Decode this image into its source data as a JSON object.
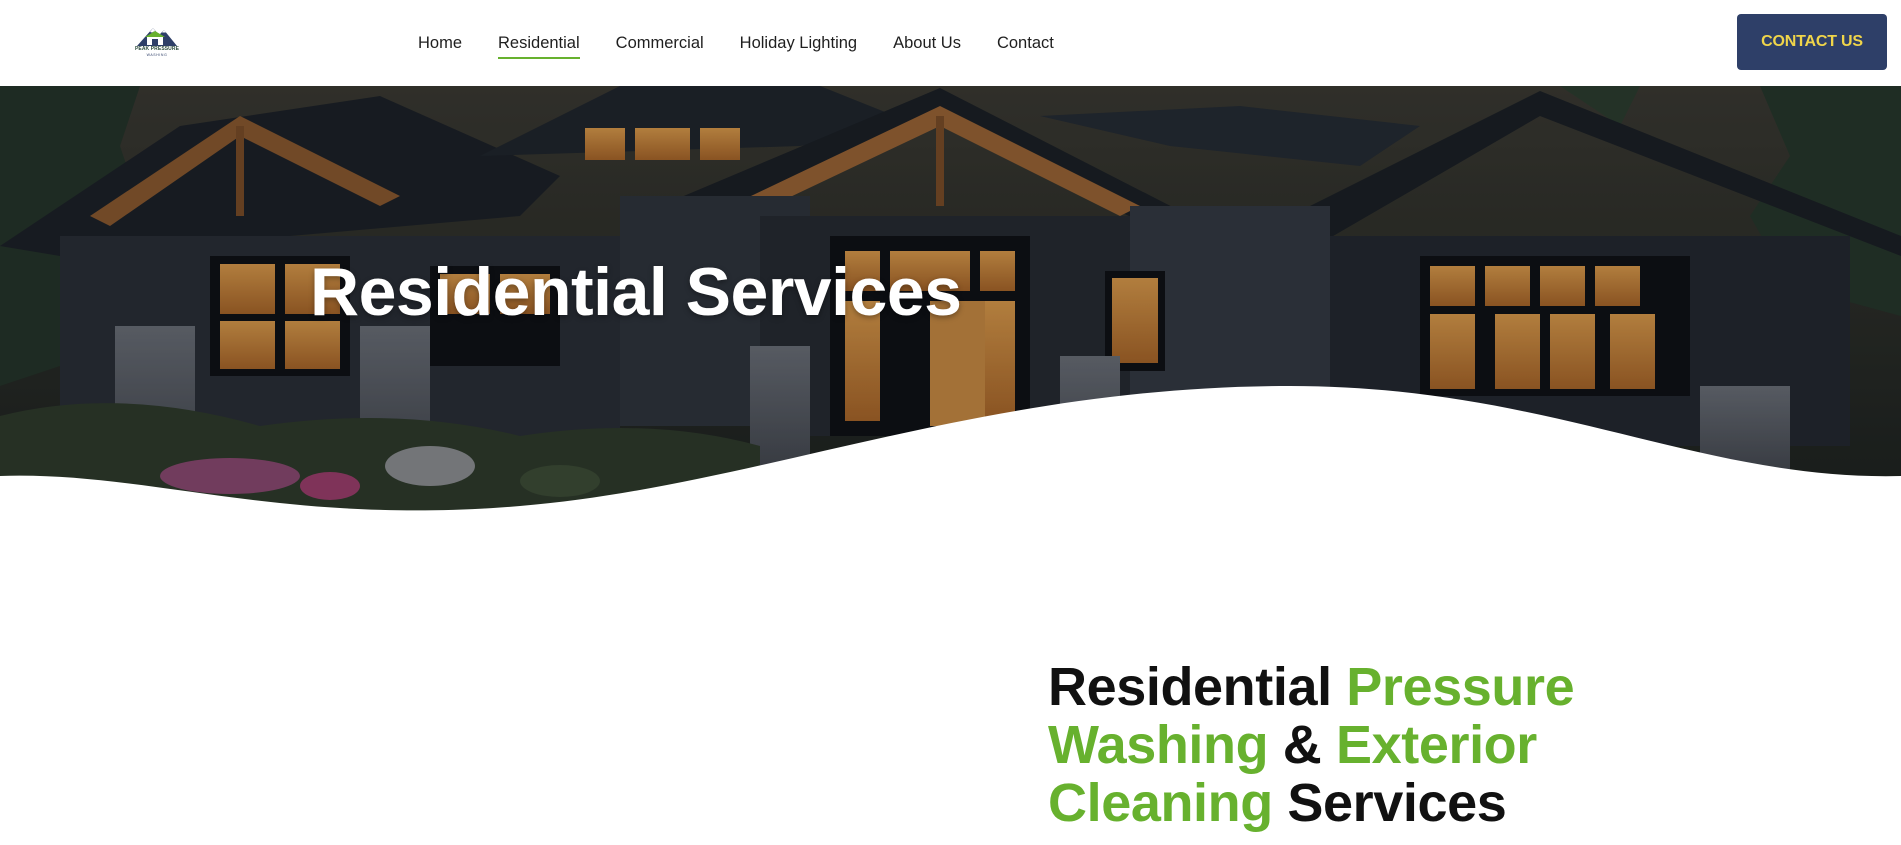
{
  "header": {
    "logo_text": "PEAK PRESSURE",
    "logo_sub": "WASHING",
    "nav": [
      {
        "label": "Home",
        "active": false
      },
      {
        "label": "Residential",
        "active": true
      },
      {
        "label": "Commercial",
        "active": false
      },
      {
        "label": "Holiday Lighting",
        "active": false
      },
      {
        "label": "About Us",
        "active": false
      },
      {
        "label": "Contact",
        "active": false
      }
    ],
    "cta_label": "CONTACT US"
  },
  "hero": {
    "title": "Residential Services"
  },
  "section": {
    "heading_parts": [
      {
        "text": "Residential ",
        "highlight": false
      },
      {
        "text": "Pressure Washing",
        "highlight": true
      },
      {
        "text": " & ",
        "highlight": false
      },
      {
        "text": "Exterior Cleaning",
        "highlight": true
      },
      {
        "text": " Services",
        "highlight": false
      }
    ]
  },
  "colors": {
    "brand_navy": "#2e3f68",
    "brand_green": "#67b12e",
    "cta_text": "#f0d54a"
  }
}
